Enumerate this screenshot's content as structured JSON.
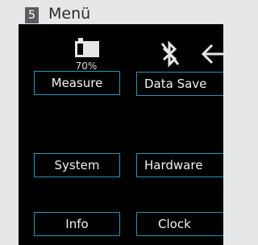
{
  "header": {
    "step_number": "5",
    "title": "Menü"
  },
  "status": {
    "battery_percent": "70%",
    "battery_level": 0.7
  },
  "icons": {
    "battery": "battery-icon",
    "bluetooth": "bluetooth-off-icon",
    "back": "back-arrow-icon"
  },
  "menu": {
    "measure": "Measure",
    "data_save": "Data Save",
    "system": "System",
    "hardware": "Hardware",
    "info": "Info",
    "clock": "Clock"
  },
  "colors": {
    "accent_border": "#2a93b6",
    "screen_bg": "#000000",
    "badge_bg": "#5b5d60"
  }
}
